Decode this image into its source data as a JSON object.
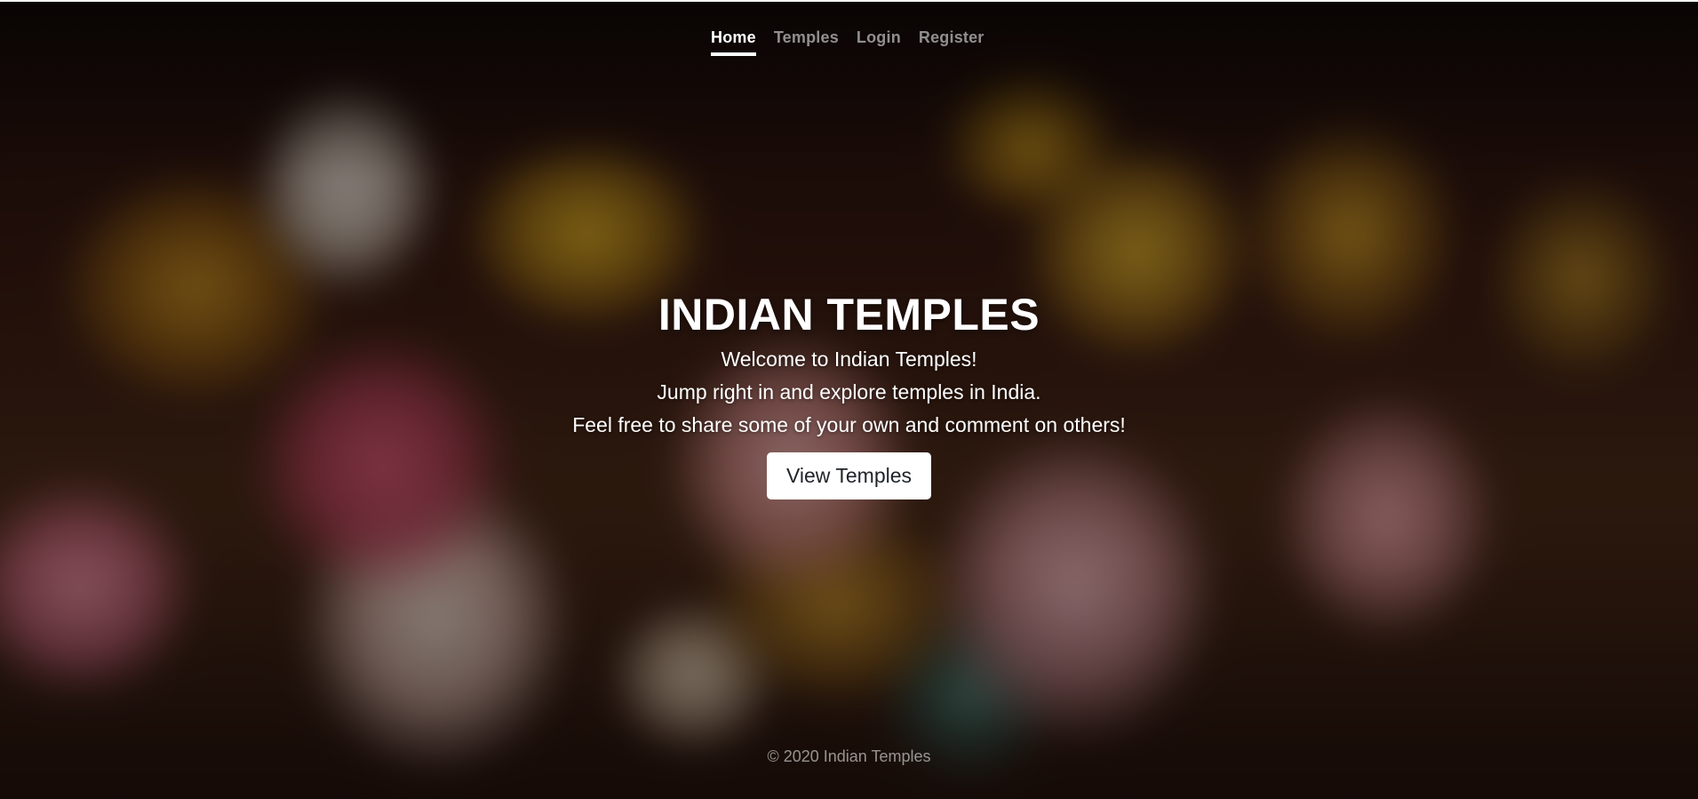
{
  "nav": {
    "items": [
      {
        "label": "Home",
        "active": true
      },
      {
        "label": "Temples",
        "active": false
      },
      {
        "label": "Login",
        "active": false
      },
      {
        "label": "Register",
        "active": false
      }
    ]
  },
  "hero": {
    "title": "INDIAN TEMPLES",
    "lines": [
      "Welcome to Indian Temples!",
      "Jump right in and explore temples in India.",
      "Feel free to share some of your own and comment on others!"
    ],
    "button_label": "View Temples",
    "background": "blurred-ganesha-idols-photo"
  },
  "footer": {
    "text": "© 2020 Indian Temples"
  },
  "colors": {
    "text": "#ffffff",
    "nav_inactive": "rgba(255,255,255,0.55)",
    "button_bg": "#ffffff",
    "button_text": "#212529"
  }
}
